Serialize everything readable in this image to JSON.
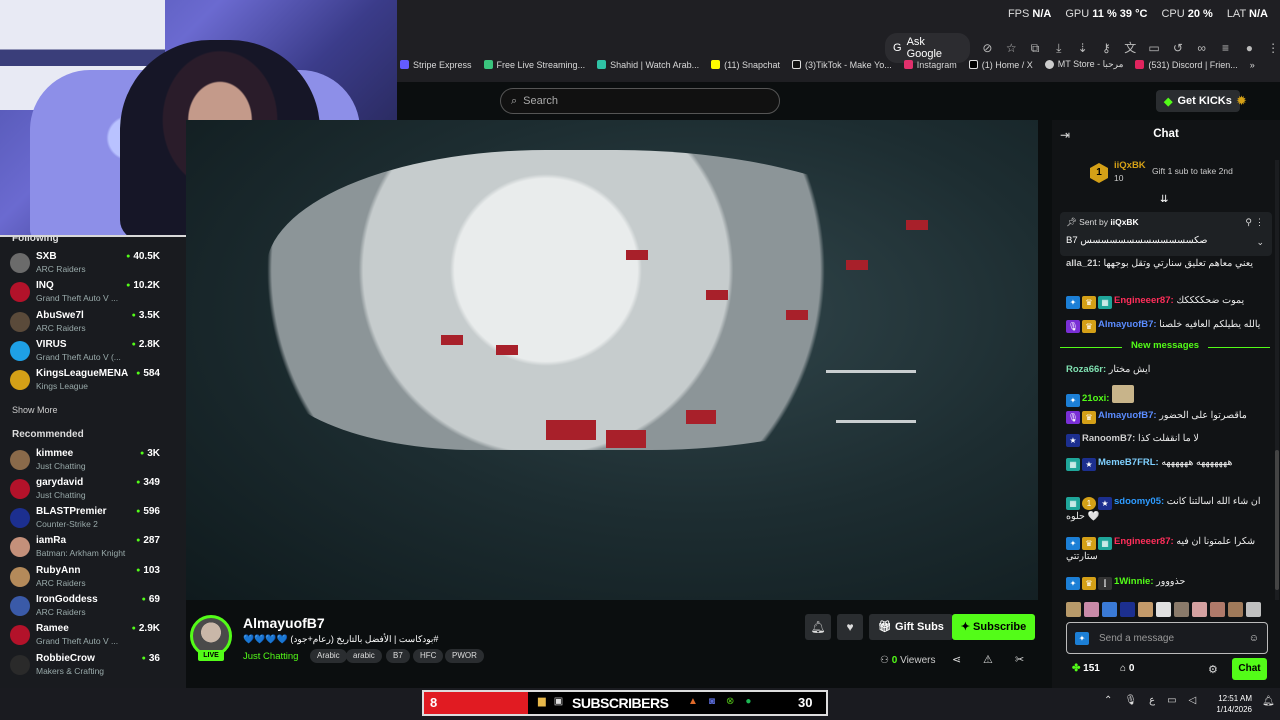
{
  "stats": {
    "fps_label": "FPS",
    "fps_value": "N/A",
    "gpu_label": "GPU",
    "gpu_value": "11 % 39 °C",
    "cpu_label": "CPU",
    "cpu_value": "20 %",
    "lat_label": "LAT",
    "lat_value": "N/A"
  },
  "browser": {
    "ask_google": "Ask Google",
    "bookmarks": [
      "Stripe Express",
      "Free Live Streaming...",
      "Shahid | Watch Arab...",
      "(11) Snapchat",
      "(3)TikTok - Make Yo...",
      "Instagram",
      "(1) Home / X",
      "MT Store - مرحبا",
      "(531) Discord | Frien..."
    ]
  },
  "header": {
    "search_placeholder": "Search",
    "get_kicks": "Get KICKs"
  },
  "sidebar": {
    "following_label": "Following",
    "following": [
      {
        "name": "SXB",
        "category": "ARC Raiders",
        "viewers": "40.5K",
        "color": "#6b6b6b"
      },
      {
        "name": "INQ",
        "category": "Grand Theft Auto V ...",
        "viewers": "10.2K",
        "color": "#b3122a"
      },
      {
        "name": "AbuSwe7l",
        "category": "ARC Raiders",
        "viewers": "3.5K",
        "color": "#5a4a3a"
      },
      {
        "name": "VIRUS",
        "category": "Grand Theft Auto V (...",
        "viewers": "2.8K",
        "color": "#1ea0e6"
      },
      {
        "name": "KingsLeagueMENA",
        "category": "Kings League",
        "viewers": "584",
        "color": "#d4a017"
      }
    ],
    "show_more": "Show More",
    "recommended_label": "Recommended",
    "recommended": [
      {
        "name": "kimmee",
        "category": "Just Chatting",
        "viewers": "3K",
        "color": "#8a6a4a"
      },
      {
        "name": "garydavid",
        "category": "Just Chatting",
        "viewers": "349",
        "color": "#b3122a"
      },
      {
        "name": "BLASTPremier",
        "category": "Counter-Strike 2",
        "viewers": "596",
        "color": "#1c2f8f"
      },
      {
        "name": "iamRa",
        "category": "Batman: Arkham Knight",
        "viewers": "287",
        "color": "#c4907a"
      },
      {
        "name": "RubyAnn",
        "category": "ARC Raiders",
        "viewers": "103",
        "color": "#b48a5a"
      },
      {
        "name": "IronGoddess",
        "category": "ARC Raiders",
        "viewers": "69",
        "color": "#3a5aa8"
      },
      {
        "name": "Ramee",
        "category": "Grand Theft Auto V ...",
        "viewers": "2.9K",
        "color": "#b3122a"
      },
      {
        "name": "RobbieCrow",
        "category": "Makers & Crafting",
        "viewers": "36",
        "color": "#2a2a2a"
      }
    ]
  },
  "stream": {
    "channel": "AlmayuofB7",
    "live": "LIVE",
    "title": "#بودكاست | الأفضل بالتاريخ (رعام+جود) 💙💙💙💙",
    "category": "Just Chatting",
    "tags": [
      "Arabic",
      "arabic",
      "B7",
      "HFC",
      "PWOR"
    ],
    "gift_subs": "Gift Subs",
    "subscribe": "Subscribe",
    "viewers_count": "0",
    "viewers_label": "Viewers"
  },
  "chat": {
    "title": "Chat",
    "top_gifter": {
      "name": "iiQxBK",
      "rank": "1",
      "count": "10",
      "gift_text": "Gift 1 sub to take 2nd"
    },
    "pinned": {
      "sent_by": "Sent by",
      "user": "iiQxBK",
      "text": "B7 صكسسسسسسسسسسسسس"
    },
    "messages_before": [
      {
        "user": "alla_21:",
        "text": "يعني معاهم تعليق سنارتي وتقل بوجهها",
        "color": "#cfcfcf"
      },
      {
        "user": "Engineeer87:",
        "text": "يموت ضحككككك",
        "color": "#ff2e5a"
      },
      {
        "user": "AlmayuofB7:",
        "text": "يالله يطيلكم العافيه خلصنا",
        "color": "#5b8cff"
      }
    ],
    "new_messages": "New messages",
    "messages_after": [
      {
        "user": "Roza66r:",
        "text": "ايش مختار",
        "color": "#7fe0b0"
      },
      {
        "user": "21oxi:",
        "text": "",
        "color": "#53fc18"
      },
      {
        "user": "AlmayuofB7:",
        "text": "ماقصرتوا على الحضور",
        "color": "#5b8cff"
      },
      {
        "user": "RanoomB7:",
        "text": "لا ما انقفلت كذا",
        "color": "#cfcfcf"
      },
      {
        "user": "MemeB7FRL:",
        "text": "هههههههه ههههههه",
        "color": "#7fd0ff"
      },
      {
        "user": "sdoomy05:",
        "text": "ان شاء الله اسالتنا كانت حلوه 🤍",
        "color": "#2e9bff"
      },
      {
        "user": "Engineeer87:",
        "text": "شكرا علمتونا ان فيه ستارتتي",
        "color": "#ff2e5a"
      },
      {
        "user": "1Winnie:",
        "text": "حذووور",
        "color": "#53fc18"
      }
    ],
    "send_placeholder": "Send a message",
    "kicks_balance": "151",
    "points_balance": "0",
    "chat_button": "Chat"
  },
  "overlay": {
    "sub_count": "8",
    "sub_label": "SUBSCRIBERS",
    "sub_goal": "30"
  },
  "taskbar": {
    "lang": "ع",
    "time": "12:51 AM",
    "date": "1/14/2026"
  },
  "colors": {
    "accent": "#53fc18",
    "background": "#0b0e0f"
  }
}
